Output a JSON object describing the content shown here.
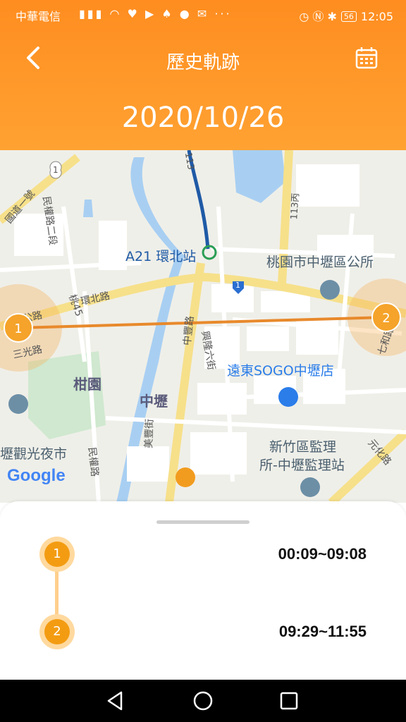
{
  "status_bar": {
    "carrier": "中華電信",
    "battery": "56",
    "time": "12:05"
  },
  "header": {
    "title": "歷史軌跡",
    "date": "2020/10/26",
    "back_icon": "chevron-left-icon",
    "calendar_icon": "calendar-icon"
  },
  "map": {
    "labels": {
      "station": "A21 環北站",
      "district_office": "桃園市中壢區公所",
      "sogo": "遠東SOGO中壢店",
      "guanyuan": "柑園",
      "zhongli": "中壢",
      "supervision_1": "新竹區監理",
      "supervision_2": "所-中壢監理站",
      "night_market": "壢觀光夜市",
      "google": "Google",
      "road_huanbei": "環北路",
      "road_zhongfeng": "中豐路",
      "road_xinglong": "興隆六街",
      "road_minquan2": "民權路二段",
      "road_minquan": "民權路",
      "road_meifeng": "美豐街",
      "road_sanguang": "三光路",
      "road_qihe": "七和路",
      "road_yuanhua": "元化路",
      "road_tao45": "桃45",
      "road_113": "113",
      "road_113bing": "113丙",
      "road_guodao": "國道一號",
      "road_gong": "公路",
      "shield_1a": "1",
      "shield_1b": "1"
    },
    "pins": [
      {
        "label": "1"
      },
      {
        "label": "2"
      }
    ],
    "route_color": "#e8892b"
  },
  "trips": [
    {
      "index": "1",
      "time": "00:09~09:08"
    },
    {
      "index": "2",
      "time": "09:29~11:55"
    }
  ],
  "colors": {
    "accent": "#ff8d20",
    "pin": "#f5a32a"
  }
}
